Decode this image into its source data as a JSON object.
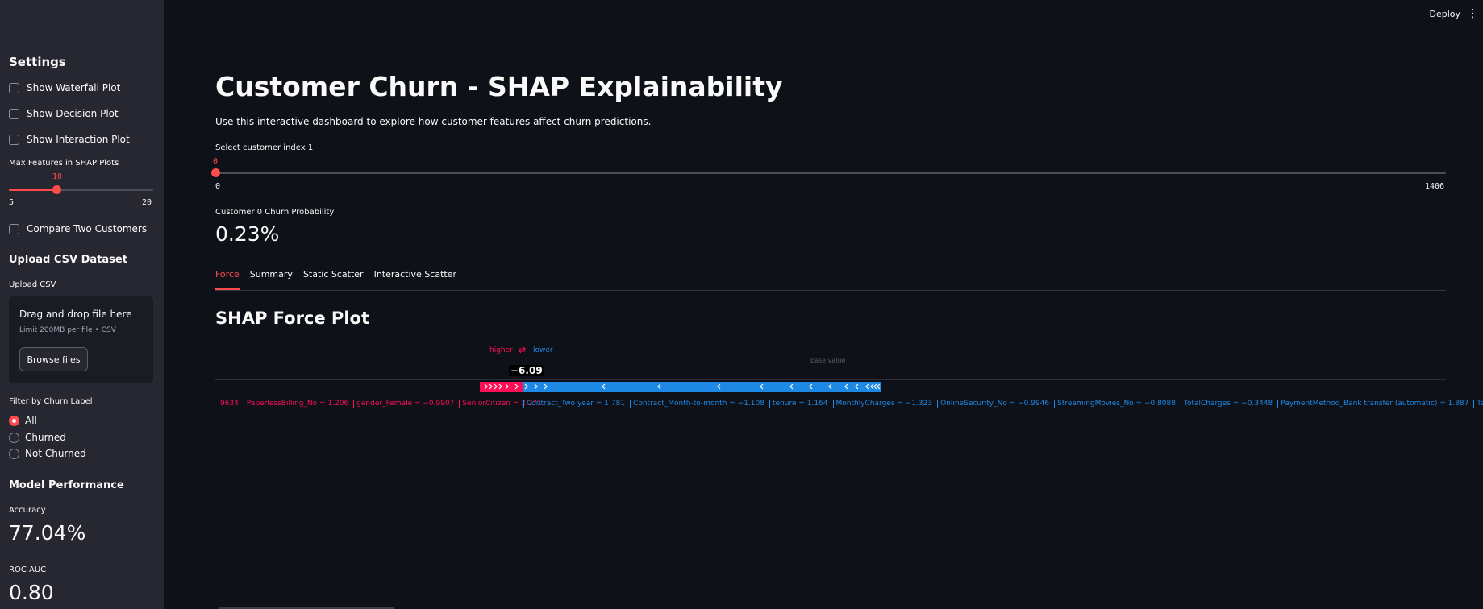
{
  "sidebar": {
    "settings_title": "Settings",
    "checkboxes": [
      "Show Waterfall Plot",
      "Show Decision Plot",
      "Show Interaction Plot"
    ],
    "max_features": {
      "label": "Max Features in SHAP Plots",
      "value": "10",
      "min": "5",
      "max": "20",
      "fraction": 0.333
    },
    "compare_label": "Compare Two Customers",
    "upload_title": "Upload CSV Dataset",
    "upload_label": "Upload CSV",
    "drop_text": "Drag and drop file here",
    "limit_text": "Limit 200MB per file • CSV",
    "browse_label": "Browse files",
    "filter_label": "Filter by Churn Label",
    "radios": [
      "All",
      "Churned",
      "Not Churned"
    ],
    "radio_selected": "All",
    "perf_title": "Model Performance",
    "accuracy_label": "Accuracy",
    "accuracy_value": "77.04%",
    "rocauc_label": "ROC AUC",
    "rocauc_value": "0.80"
  },
  "topbar": {
    "deploy_label": "Deploy",
    "menu_icon": "kebab-menu-icon"
  },
  "main": {
    "title": "Customer Churn - SHAP Explainability",
    "description": "Use this interactive dashboard to explore how customer features affect churn predictions.",
    "index_slider": {
      "label": "Select customer index 1",
      "value": "0",
      "min": "0",
      "max": "1406",
      "fraction": 0.0
    },
    "prob_label": "Customer 0 Churn Probability",
    "prob_value": "0.23%",
    "tabs": [
      "Force",
      "Summary",
      "Static Scatter",
      "Interactive Scatter"
    ],
    "active_tab": "Force",
    "section_title": "SHAP Force Plot"
  },
  "force_plot": {
    "higher_label": "higher",
    "lower_label": "lower",
    "output_value": "−6.09",
    "base_label": "base value",
    "colors": {
      "positive": "#ff0d57",
      "negative": "#1e88e5"
    },
    "positive_features": [
      "9634",
      "PaperlessBilling_No = 1.206",
      "gender_Female = −0.9907",
      "SeniorCitizen = 2.271"
    ],
    "negative_features": [
      "Contract_Two year = 1.781",
      "Contract_Month-to-month = −1.108",
      "tenure = 1.164",
      "MonthlyCharges = −1.323",
      "OnlineSecurity_No = −0.9946",
      "StreamingMovies_No = −0.8088",
      "TotalCharges = −0.3448",
      "PaymentMethod_Bank transfer (automatic) = 1.887",
      "TechSupp"
    ]
  }
}
